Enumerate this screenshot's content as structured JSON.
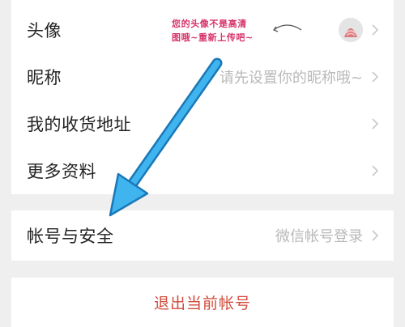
{
  "settings": {
    "avatar_label": "头像",
    "avatar_hint_line1": "您的头像不是高清",
    "avatar_hint_line2": "图哦~重新上传吧~",
    "nickname_label": "昵称",
    "nickname_placeholder": "请先设置你的昵称哦~",
    "address_label": "我的收货地址",
    "more_info_label": "更多资料"
  },
  "account": {
    "security_label": "帐号与安全",
    "login_method": "微信帐号登录"
  },
  "logout": {
    "label": "退出当前帐号"
  },
  "icons": [
    "chevron-right-icon",
    "avatar-icon",
    "annotation-arrow"
  ],
  "colors": {
    "hint": "#d6336c",
    "logout": "#d24b3c",
    "arrow": "#2ea7e8",
    "muted": "#b9b9b9"
  }
}
